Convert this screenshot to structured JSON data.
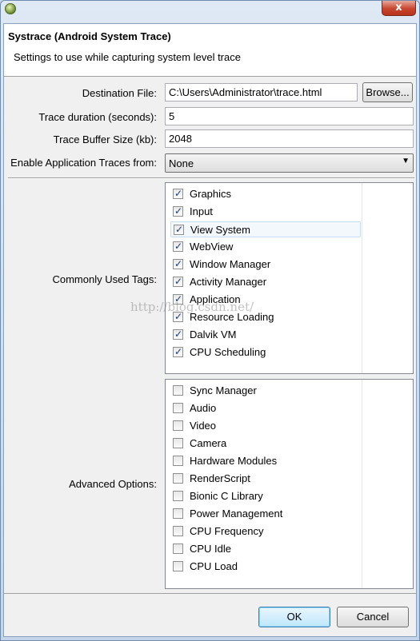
{
  "window": {
    "close_glyph": "x"
  },
  "header": {
    "title": "Systrace (Android System Trace)",
    "description": "Settings to use while capturing system level trace"
  },
  "form": {
    "destination_label": "Destination File:",
    "destination_value": "C:\\Users\\Administrator\\trace.html",
    "browse_label": "Browse...",
    "duration_label": "Trace duration (seconds):",
    "duration_value": "5",
    "buffer_label": "Trace Buffer Size (kb):",
    "buffer_value": "2048",
    "app_traces_label": "Enable Application Traces from:",
    "app_traces_value": "None"
  },
  "common_tags": {
    "label": "Commonly Used Tags:",
    "items": [
      {
        "label": "Graphics",
        "checked": true
      },
      {
        "label": "Input",
        "checked": true
      },
      {
        "label": "View System",
        "checked": true
      },
      {
        "label": "WebView",
        "checked": true
      },
      {
        "label": "Window Manager",
        "checked": true
      },
      {
        "label": "Activity Manager",
        "checked": true
      },
      {
        "label": "Application",
        "checked": true
      },
      {
        "label": "Resource Loading",
        "checked": true
      },
      {
        "label": "Dalvik VM",
        "checked": true
      },
      {
        "label": "CPU Scheduling",
        "checked": true
      }
    ]
  },
  "advanced": {
    "label": "Advanced Options:",
    "items": [
      {
        "label": "Sync Manager",
        "checked": false
      },
      {
        "label": "Audio",
        "checked": false
      },
      {
        "label": "Video",
        "checked": false
      },
      {
        "label": "Camera",
        "checked": false
      },
      {
        "label": "Hardware Modules",
        "checked": false
      },
      {
        "label": "RenderScript",
        "checked": false
      },
      {
        "label": "Bionic C Library",
        "checked": false
      },
      {
        "label": "Power Management",
        "checked": false
      },
      {
        "label": "CPU Frequency",
        "checked": false
      },
      {
        "label": "CPU Idle",
        "checked": false
      },
      {
        "label": "CPU Load",
        "checked": false
      }
    ]
  },
  "buttons": {
    "ok": "OK",
    "cancel": "Cancel"
  },
  "watermark": "http://blog.csdn.net/"
}
